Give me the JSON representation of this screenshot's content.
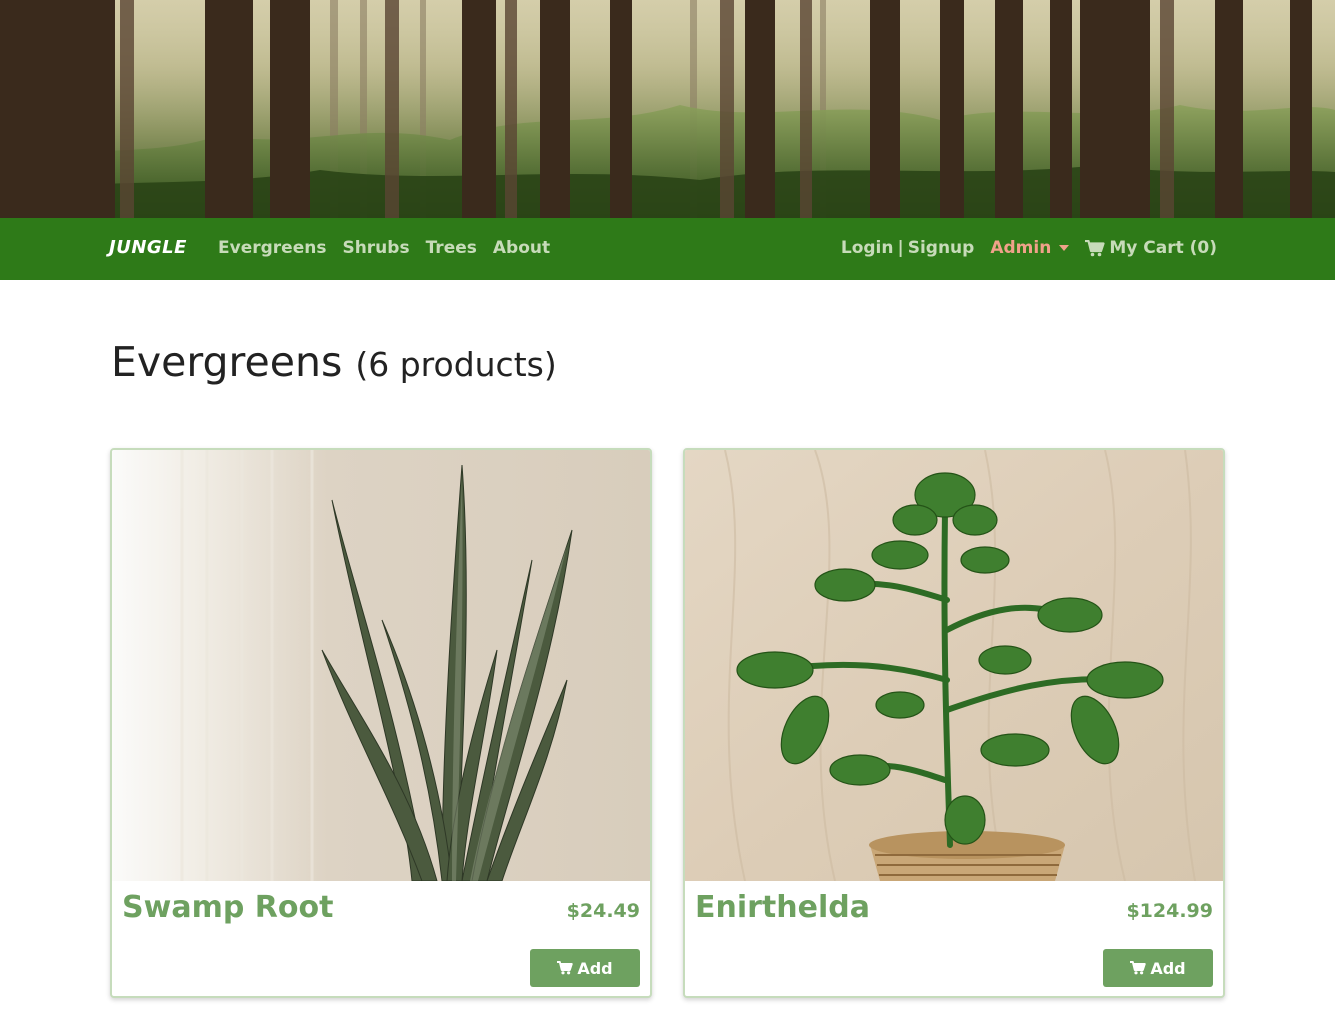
{
  "colors": {
    "navbar": "#2e7a18",
    "nav_link": "#c7dbb9",
    "admin": "#f0a28a",
    "accent": "#6ea160",
    "card_border": "#c6dcbc"
  },
  "navbar": {
    "brand": "JUNGLE",
    "links": [
      {
        "label": "Evergreens"
      },
      {
        "label": "Shrubs"
      },
      {
        "label": "Trees"
      },
      {
        "label": "About"
      }
    ],
    "login_label": "Login",
    "separator": "|",
    "signup_label": "Signup",
    "admin_label": "Admin",
    "cart_label": "My Cart (0)",
    "cart_icon": "cart-icon"
  },
  "page": {
    "title": "Evergreens",
    "count": "(6 products)"
  },
  "products": [
    {
      "name": "Swamp Root",
      "price": "$24.49",
      "button_label": "Add",
      "image": "snake-plant-photo"
    },
    {
      "name": "Enirthelda",
      "price": "$124.99",
      "button_label": "Add",
      "image": "jade-plant-in-basket-photo"
    }
  ]
}
